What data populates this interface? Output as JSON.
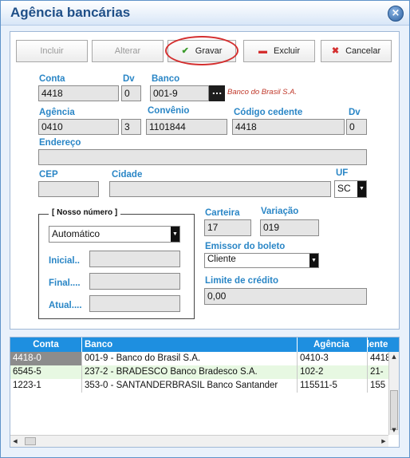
{
  "window": {
    "title": "Agência bancárias",
    "close_icon": "×"
  },
  "toolbar": {
    "incluir": "Incluir",
    "alterar": "Alterar",
    "gravar": "Gravar",
    "excluir": "Excluir",
    "cancelar": "Cancelar"
  },
  "form": {
    "conta_label": "Conta",
    "conta_value": "4418",
    "conta_dv_label": "Dv",
    "conta_dv_value": "0",
    "banco_label": "Banco",
    "banco_value": "001-9",
    "banco_lookup": "...",
    "banco_name": "Banco do Brasil S.A.",
    "agencia_label": "Agência",
    "agencia_value": "0410",
    "agencia_dv_value": "3",
    "convenio_label": "Convênio",
    "convenio_value": "1101844",
    "codigo_cedente_label": "Código cedente",
    "codigo_cedente_value": "4418",
    "cedente_dv_label": "Dv",
    "cedente_dv_value": "0",
    "endereco_label": "Endereço",
    "endereco_value": "",
    "cep_label": "CEP",
    "cep_value": "",
    "cidade_label": "Cidade",
    "cidade_value": "",
    "uf_label": "UF",
    "uf_value": "SC"
  },
  "nosso_numero": {
    "title": "[ Nosso número ]",
    "mode_value": "Automático",
    "inicial_label": "Inicial..",
    "final_label": "Final....",
    "atual_label": "Atual...."
  },
  "boleto": {
    "carteira_label": "Carteira",
    "carteira_value": "17",
    "variacao_label": "Variação",
    "variacao_value": "019",
    "emissor_label": "Emissor do boleto",
    "emissor_value": "Cliente",
    "limite_label": "Limite de crédito",
    "limite_value": "0,00"
  },
  "grid": {
    "columns": [
      "Conta",
      "Banco",
      "Agência",
      "Cedente"
    ],
    "rows": [
      {
        "conta": "4418-0",
        "banco": "001-9 - Banco do Brasil S.A.",
        "agencia": "0410-3",
        "cedente": "4418"
      },
      {
        "conta": "6545-5",
        "banco": "237-2 - BRADESCO Banco Bradesco S.A.",
        "agencia": "102-2",
        "cedente": "21-"
      },
      {
        "conta": "1223-1",
        "banco": "353-0 - SANTANDERBRASIL Banco Santander",
        "agencia": "115511-5",
        "cedente": "155"
      }
    ]
  },
  "colors": {
    "accent": "#2a86c6",
    "header": "#1e8fe0",
    "highlight_ring": "#d42f2f",
    "row_alt": "#e7f8e2",
    "selected_cell": "#8c8c8c"
  }
}
